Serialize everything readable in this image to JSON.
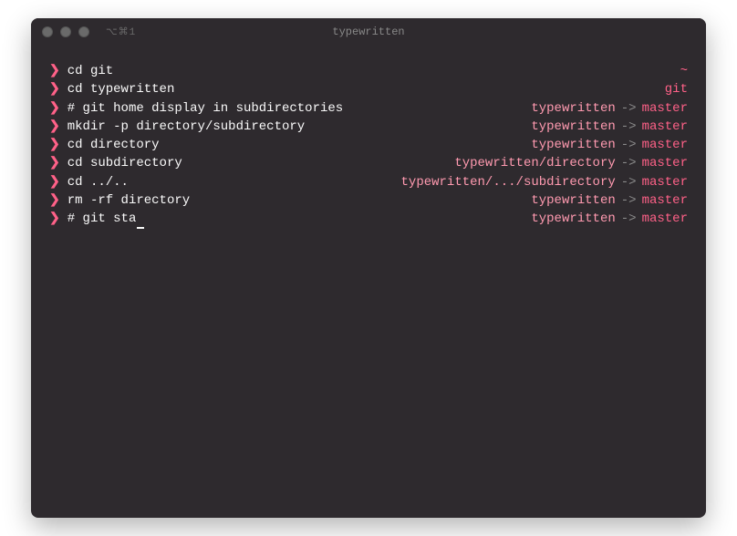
{
  "window": {
    "title": "typewritten",
    "tab_hint": "⌥⌘1"
  },
  "lines": [
    {
      "command": "cd git",
      "right_path": "~",
      "right_branch": ""
    },
    {
      "command": "cd typewritten",
      "right_path": "git",
      "right_branch": ""
    },
    {
      "command": "# git home display in subdirectories",
      "right_path": "typewritten",
      "right_branch": "master"
    },
    {
      "command": "mkdir -p directory/subdirectory",
      "right_path": "typewritten",
      "right_branch": "master"
    },
    {
      "command": "cd directory",
      "right_path": "typewritten",
      "right_branch": "master"
    },
    {
      "command": "cd subdirectory",
      "right_path": "typewritten/directory",
      "right_branch": "master"
    },
    {
      "command": "cd ../..",
      "right_path": "typewritten/.../subdirectory",
      "right_branch": "master"
    },
    {
      "command": "rm -rf directory",
      "right_path": "typewritten",
      "right_branch": "master"
    },
    {
      "command": "# git sta",
      "right_path": "typewritten",
      "right_branch": "master",
      "cursor": true
    }
  ],
  "symbols": {
    "prompt": "❯",
    "arrow": "->"
  }
}
